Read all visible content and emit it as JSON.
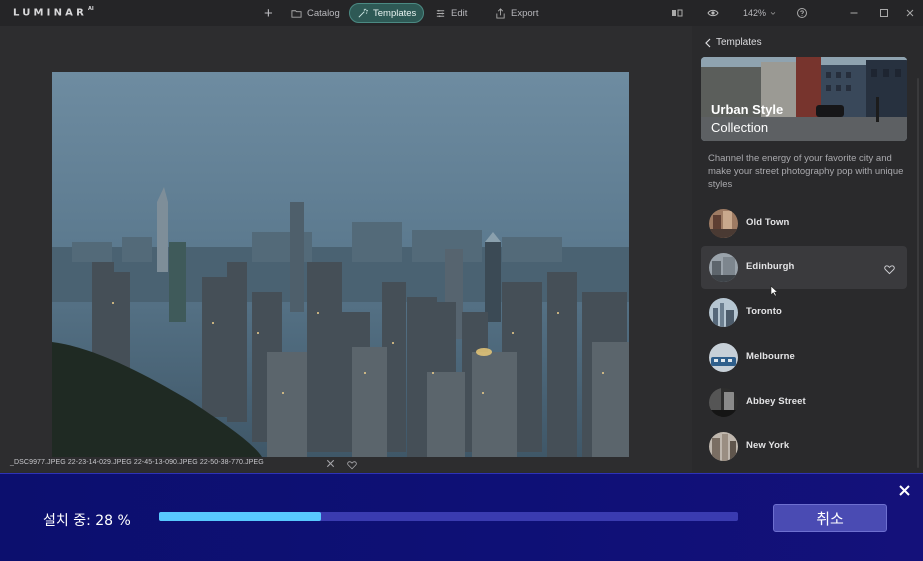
{
  "app": {
    "logo": "LUMINAR",
    "logo_suffix": "AI"
  },
  "nav": {
    "add": "+",
    "catalog": "Catalog",
    "templates": "Templates",
    "edit": "Edit",
    "export": "Export"
  },
  "toolbar": {
    "zoom": "142%"
  },
  "image": {
    "filename": "_DSC9977.JPEG 22-23-14-029.JPEG 22-45-13-090.JPEG 22-50-38-770.JPEG"
  },
  "panel": {
    "back_label": "Templates",
    "hero_title": "Urban Style",
    "hero_subtitle": "Collection",
    "description": "Channel the energy of your favorite city and make your street photography pop with unique styles",
    "templates": [
      {
        "name": "Old Town"
      },
      {
        "name": "Edinburgh"
      },
      {
        "name": "Toronto"
      },
      {
        "name": "Melbourne"
      },
      {
        "name": "Abbey Street"
      },
      {
        "name": "New York"
      }
    ]
  },
  "install": {
    "status": "설치 중: 28 %",
    "progress": 0.28,
    "cancel_label": "취소"
  },
  "colors": {
    "accent": "#2e5955",
    "progress": "#58c9ff",
    "install_bg": "#0e1076"
  }
}
